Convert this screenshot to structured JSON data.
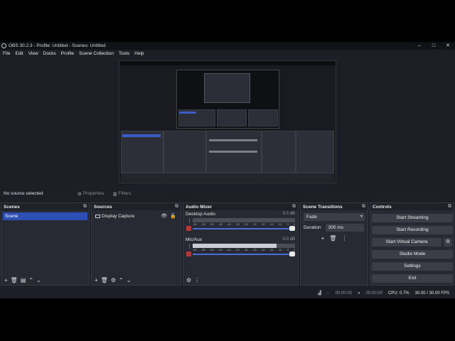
{
  "window": {
    "title": "OBS 30.2.3 - Profile: Untitled - Scenes: Untitled",
    "controls": [
      "–",
      "□",
      "✕"
    ]
  },
  "menu": [
    "File",
    "Edit",
    "View",
    "Docks",
    "Profile",
    "Scene Collection",
    "Tools",
    "Help"
  ],
  "status_row": {
    "no_source": "No source selected",
    "properties": "Properties",
    "filters": "Filters"
  },
  "scenes": {
    "title": "Scenes",
    "items": [
      "Scene"
    ]
  },
  "sources": {
    "title": "Sources",
    "items": [
      "Display Capture"
    ]
  },
  "mixer": {
    "title": "Audio Mixer",
    "channels": [
      {
        "name": "Desktop Audio",
        "db": "0.0 dB",
        "level": 0.0
      },
      {
        "name": "Mic/Aux",
        "db": "0.0 dB",
        "level": 0.82
      }
    ],
    "ticks": [
      "-60",
      "-55",
      "-50",
      "-45",
      "-40",
      "-35",
      "-30",
      "-25",
      "-20",
      "-15",
      "-10",
      "-5",
      "0"
    ]
  },
  "transitions": {
    "title": "Scene Transitions",
    "type": "Fade",
    "duration_label": "Duration",
    "duration_value": "300 ms"
  },
  "controls": {
    "title": "Controls",
    "start_streaming": "Start Streaming",
    "start_recording": "Start Recording",
    "start_virtual_camera": "Start Virtual Camera",
    "studio_mode": "Studio Mode",
    "settings": "Settings",
    "exit": "Exit"
  },
  "statusbar": {
    "stream_time": "00:00:00",
    "rec_time": "00:00:00",
    "cpu": "CPU: 0.7%",
    "fps": "30.00 / 30.00 FPS"
  }
}
